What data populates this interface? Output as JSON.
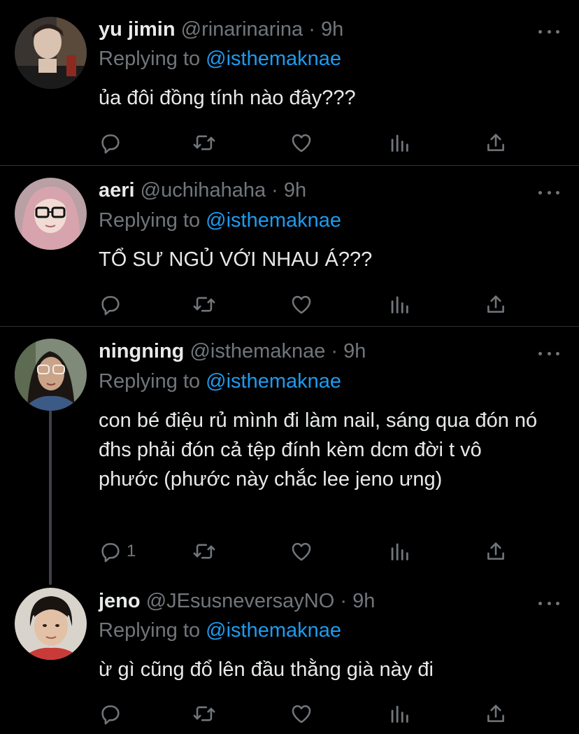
{
  "tweets": [
    {
      "name": "yu jimin",
      "handle": "@rinarinarina",
      "separator": "·",
      "time": "9h",
      "replying_prefix": "Replying to",
      "replying_to": "@isthemaknae",
      "text": "ủa đôi đồng tính nào đây???",
      "reply_count": ""
    },
    {
      "name": "aeri",
      "handle": "@uchihahaha",
      "separator": "·",
      "time": "9h",
      "replying_prefix": "Replying to",
      "replying_to": "@isthemaknae",
      "text": "TỔ SƯ NGỦ VỚI NHAU Á???",
      "reply_count": ""
    },
    {
      "name": "ningning",
      "handle": "@isthemaknae",
      "separator": "·",
      "time": "9h",
      "replying_prefix": "Replying to",
      "replying_to": "@isthemaknae",
      "text": "con bé điệu rủ mình đi làm nail, sáng qua đón nó đhs phải đón cả tệp đính kèm dcm đời t vô phước (phước này chắc lee jeno ưng)",
      "reply_count": "1"
    },
    {
      "name": "jeno",
      "handle": "@JEsusneversayNO",
      "separator": "·",
      "time": "9h",
      "replying_prefix": "Replying to",
      "replying_to": "@isthemaknae",
      "text": "ừ gì cũng đổ lên đầu thằng già này đi",
      "reply_count": ""
    }
  ],
  "icons": {
    "reply": "reply-icon",
    "retweet": "retweet-icon",
    "like": "heart-icon",
    "analytics": "analytics-icon",
    "share": "share-icon",
    "more": "more-icon"
  },
  "colors": {
    "background": "#000000",
    "text_primary": "#e7e9ea",
    "text_secondary": "#71767b",
    "accent": "#1d9bf0",
    "divider": "#2f3336"
  }
}
